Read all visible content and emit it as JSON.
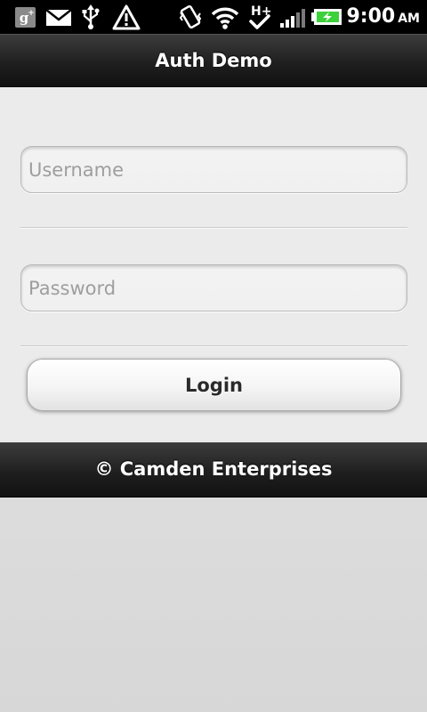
{
  "status_bar": {
    "time": "9:00",
    "ampm": "AM",
    "icons": [
      "google-plus-icon",
      "mail-icon",
      "usb-icon",
      "warning-icon",
      "vibrate-icon",
      "wifi-icon",
      "hspa-plus-icon",
      "signal-icon",
      "battery-charging-icon"
    ],
    "network_label": "H+"
  },
  "header": {
    "title": "Auth Demo"
  },
  "form": {
    "username_placeholder": "Username",
    "username_value": "",
    "password_placeholder": "Password",
    "password_value": "",
    "login_label": "Login"
  },
  "footer": {
    "text": "© Camden Enterprises"
  },
  "colors": {
    "bar_dark": "#1f1f1f",
    "content_bg": "#ebebeb",
    "battery_green": "#3bd13b"
  }
}
